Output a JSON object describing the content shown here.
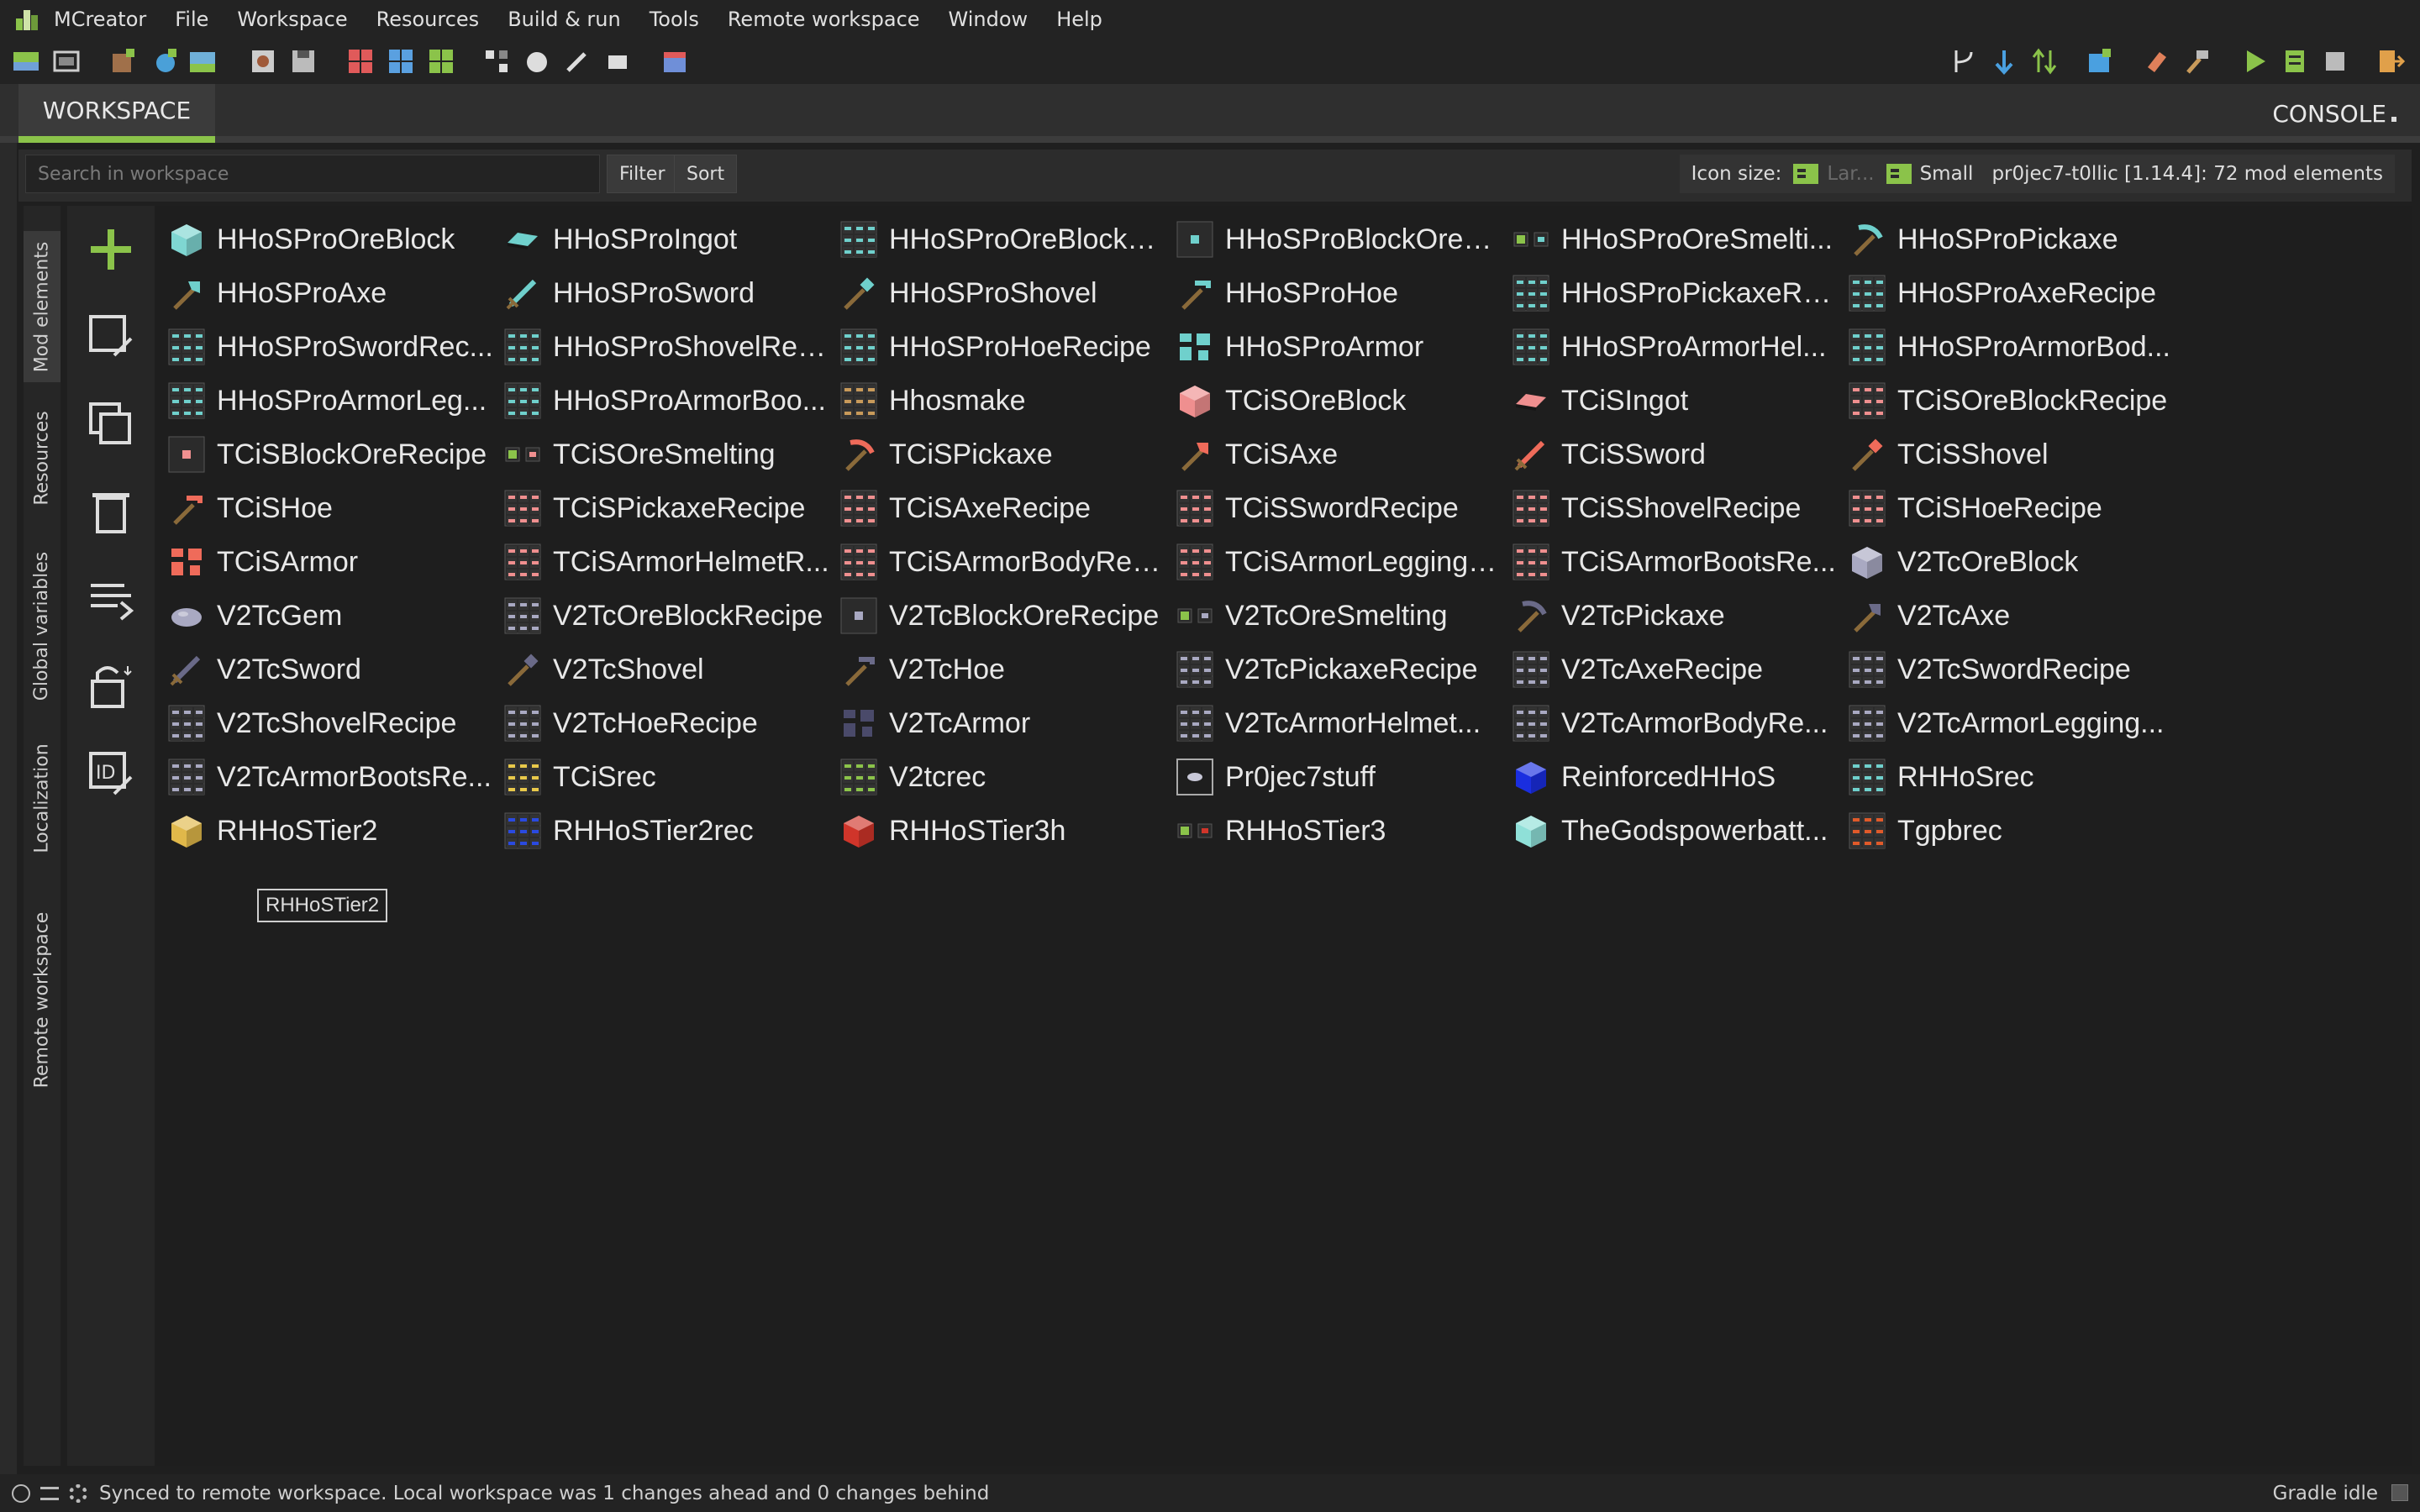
{
  "app": {
    "name": "MCreator"
  },
  "menu": [
    "MCreator",
    "File",
    "Workspace",
    "Resources",
    "Build & run",
    "Tools",
    "Remote workspace",
    "Window",
    "Help"
  ],
  "tabs": {
    "workspace": "WORKSPACE",
    "console": "CONSOLE"
  },
  "search": {
    "placeholder": "Search in workspace",
    "filter": "Filter",
    "sort": "Sort"
  },
  "icon_size": {
    "label": "Icon size:",
    "large": "Lar...",
    "small": "Small"
  },
  "workspace_info": "pr0jec7-t0llic [1.14.4]: 72 mod elements",
  "vnav": [
    "Mod elements",
    "Resources",
    "Global variables",
    "Localization",
    "Remote workspace"
  ],
  "elements": [
    {
      "name": "HHoSProOreBlock",
      "icon": "block",
      "color": "#7fd6d2"
    },
    {
      "name": "HHoSProIngot",
      "icon": "ingot",
      "color": "#6fd0cc"
    },
    {
      "name": "HHoSProOreBlockR...",
      "icon": "recipe",
      "color": "#6fd0cc"
    },
    {
      "name": "HHoSProBlockOreR...",
      "icon": "recipe-single",
      "color": "#6fd0cc"
    },
    {
      "name": "HHoSProOreSmelti...",
      "icon": "smelting",
      "color": "#6fd0cc"
    },
    {
      "name": "HHoSProPickaxe",
      "icon": "pickaxe",
      "color": "#6fd0cc"
    },
    {
      "name": "HHoSProAxe",
      "icon": "axe",
      "color": "#6fd0cc"
    },
    {
      "name": "HHoSProSword",
      "icon": "sword",
      "color": "#6fd0cc"
    },
    {
      "name": "HHoSProShovel",
      "icon": "shovel",
      "color": "#6fd0cc"
    },
    {
      "name": "HHoSProHoe",
      "icon": "hoe",
      "color": "#6fd0cc"
    },
    {
      "name": "HHoSProPickaxeRe...",
      "icon": "recipe",
      "color": "#6fd0cc"
    },
    {
      "name": "HHoSProAxeRecipe",
      "icon": "recipe",
      "color": "#6fd0cc"
    },
    {
      "name": "HHoSProSwordRec...",
      "icon": "recipe",
      "color": "#6fd0cc"
    },
    {
      "name": "HHoSProShovelRec...",
      "icon": "recipe",
      "color": "#6fd0cc"
    },
    {
      "name": "HHoSProHoeRecipe",
      "icon": "recipe",
      "color": "#6fd0cc"
    },
    {
      "name": "HHoSProArmor",
      "icon": "armor",
      "color": "#6fd0cc"
    },
    {
      "name": "HHoSProArmorHel...",
      "icon": "recipe",
      "color": "#6fd0cc"
    },
    {
      "name": "HHoSProArmorBod...",
      "icon": "recipe",
      "color": "#6fd0cc"
    },
    {
      "name": "HHoSProArmorLeg...",
      "icon": "recipe",
      "color": "#6fd0cc"
    },
    {
      "name": "HHoSProArmorBoo...",
      "icon": "recipe",
      "color": "#6fd0cc"
    },
    {
      "name": "Hhosmake",
      "icon": "recipe",
      "color": "#c89a5a"
    },
    {
      "name": "TCiSOreBlock",
      "icon": "block",
      "color": "#ef8f8f"
    },
    {
      "name": "TCiSIngot",
      "icon": "ingot",
      "color": "#ef8f8f"
    },
    {
      "name": "TCiSOreBlockRecipe",
      "icon": "recipe",
      "color": "#ef8f8f"
    },
    {
      "name": "TCiSBlockOreRecipe",
      "icon": "recipe-single",
      "color": "#ef8f8f"
    },
    {
      "name": "TCiSOreSmelting",
      "icon": "smelting",
      "color": "#ef8f8f"
    },
    {
      "name": "TCiSPickaxe",
      "icon": "pickaxe",
      "color": "#ef6b5a"
    },
    {
      "name": "TCiSAxe",
      "icon": "axe",
      "color": "#ef6b5a"
    },
    {
      "name": "TCiSSword",
      "icon": "sword",
      "color": "#ef6b5a"
    },
    {
      "name": "TCiSShovel",
      "icon": "shovel",
      "color": "#ef6b5a"
    },
    {
      "name": "TCiSHoe",
      "icon": "hoe",
      "color": "#ef6b5a"
    },
    {
      "name": "TCiSPickaxeRecipe",
      "icon": "recipe",
      "color": "#ef8f8f"
    },
    {
      "name": "TCiSAxeRecipe",
      "icon": "recipe",
      "color": "#ef8f8f"
    },
    {
      "name": "TCiSSwordRecipe",
      "icon": "recipe",
      "color": "#ef8f8f"
    },
    {
      "name": "TCiSShovelRecipe",
      "icon": "recipe",
      "color": "#ef8f8f"
    },
    {
      "name": "TCiSHoeRecipe",
      "icon": "recipe",
      "color": "#ef8f8f"
    },
    {
      "name": "TCiSArmor",
      "icon": "armor",
      "color": "#ef6b5a"
    },
    {
      "name": "TCiSArmorHelmetR...",
      "icon": "recipe",
      "color": "#ef8f8f"
    },
    {
      "name": "TCiSArmorBodyRec...",
      "icon": "recipe",
      "color": "#ef8f8f"
    },
    {
      "name": "TCiSArmorLeggings...",
      "icon": "recipe",
      "color": "#ef8f8f"
    },
    {
      "name": "TCiSArmorBootsRe...",
      "icon": "recipe",
      "color": "#ef8f8f"
    },
    {
      "name": "V2TcOreBlock",
      "icon": "block",
      "color": "#a9a9c2"
    },
    {
      "name": "V2TcGem",
      "icon": "gem",
      "color": "#a9a9c2"
    },
    {
      "name": "V2TcOreBlockRecipe",
      "icon": "recipe",
      "color": "#a9a9c2"
    },
    {
      "name": "V2TcBlockOreRecipe",
      "icon": "recipe-single",
      "color": "#a9a9c2"
    },
    {
      "name": "V2TcOreSmelting",
      "icon": "smelting",
      "color": "#a9a9c2"
    },
    {
      "name": "V2TcPickaxe",
      "icon": "pickaxe",
      "color": "#6a6a88"
    },
    {
      "name": "V2TcAxe",
      "icon": "axe",
      "color": "#6a6a88"
    },
    {
      "name": "V2TcSword",
      "icon": "sword",
      "color": "#6a6a88"
    },
    {
      "name": "V2TcShovel",
      "icon": "shovel",
      "color": "#6a6a88"
    },
    {
      "name": "V2TcHoe",
      "icon": "hoe",
      "color": "#6a6a88"
    },
    {
      "name": "V2TcPickaxeRecipe",
      "icon": "recipe",
      "color": "#a9a9c2"
    },
    {
      "name": "V2TcAxeRecipe",
      "icon": "recipe",
      "color": "#a9a9c2"
    },
    {
      "name": "V2TcSwordRecipe",
      "icon": "recipe",
      "color": "#a9a9c2"
    },
    {
      "name": "V2TcShovelRecipe",
      "icon": "recipe",
      "color": "#a9a9c2"
    },
    {
      "name": "V2TcHoeRecipe",
      "icon": "recipe",
      "color": "#a9a9c2"
    },
    {
      "name": "V2TcArmor",
      "icon": "armor",
      "color": "#4a4a6a"
    },
    {
      "name": "V2TcArmorHelmet...",
      "icon": "recipe",
      "color": "#a9a9c2"
    },
    {
      "name": "V2TcArmorBodyRe...",
      "icon": "recipe",
      "color": "#a9a9c2"
    },
    {
      "name": "V2TcArmorLegging...",
      "icon": "recipe",
      "color": "#a9a9c2"
    },
    {
      "name": "V2TcArmorBootsRe...",
      "icon": "recipe",
      "color": "#a9a9c2"
    },
    {
      "name": "TCiSrec",
      "icon": "recipe",
      "color": "#e8c84a"
    },
    {
      "name": "V2tcrec",
      "icon": "recipe",
      "color": "#8bc34a"
    },
    {
      "name": "Pr0jec7stuff",
      "icon": "framed",
      "color": "#c8c8d8"
    },
    {
      "name": "ReinforcedHHoS",
      "icon": "block",
      "color": "#1a2ee0"
    },
    {
      "name": "RHHoSrec",
      "icon": "recipe",
      "color": "#6fd0cc"
    },
    {
      "name": "RHHoSTier2",
      "icon": "block",
      "color": "#e0b84a"
    },
    {
      "name": "RHHoSTier2rec",
      "icon": "recipe",
      "color": "#2a4ae0"
    },
    {
      "name": "RHHoSTier3h",
      "icon": "block",
      "color": "#d0352a"
    },
    {
      "name": "RHHoSTier3",
      "icon": "smelting",
      "color": "#d0352a"
    },
    {
      "name": "TheGodspowerbatt...",
      "icon": "block",
      "color": "#8fe0d8"
    },
    {
      "name": "Tgpbrec",
      "icon": "recipe",
      "color": "#e05a2a"
    }
  ],
  "tooltip": "RHHoSTier2",
  "status": {
    "text": "Synced to remote workspace. Local workspace was 1 changes ahead and 0 changes behind",
    "gradle": "Gradle idle"
  },
  "colors": {
    "accent": "#8bc34a",
    "background": "#1e1e1e"
  }
}
